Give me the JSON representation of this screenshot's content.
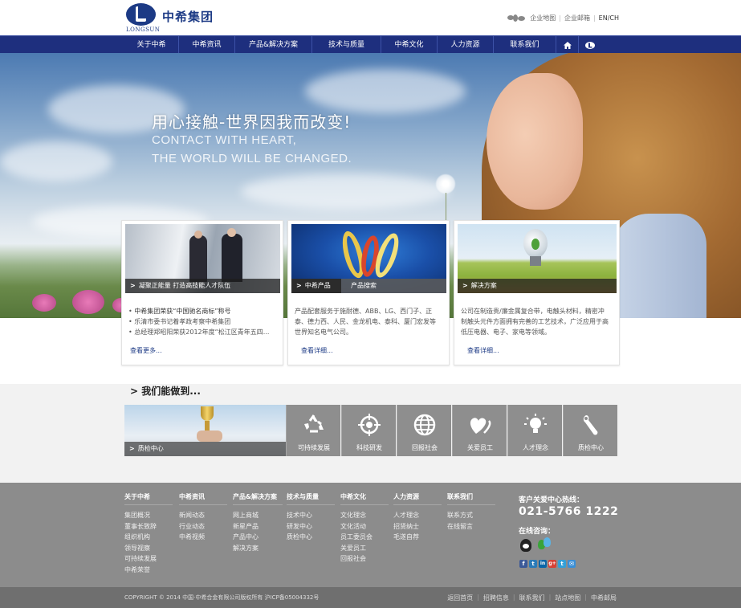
{
  "header": {
    "logo_cn": "中希集团",
    "logo_en": "LONGSUN",
    "links": [
      "企业地图",
      "企业邮箱",
      "EN/CH"
    ]
  },
  "nav": {
    "items": [
      "关于中希",
      "中希资讯",
      "产品&解决方案",
      "技术与质量",
      "中希文化",
      "人力资源",
      "联系我们"
    ],
    "home_icon": "home-icon",
    "logo_icon": "logo-small-icon"
  },
  "hero": {
    "title": "用心接触-世界因我而改变!",
    "subtitle_line1": "CONTACT WITH HEART,",
    "subtitle_line2": "THE WORLD WILL BE CHANGED."
  },
  "cards": [
    {
      "caption": "凝聚正能量 打造高技能人才队伍",
      "items": [
        "中希集团荣获“中国驰名商标”称号",
        "乐清市委书记着孝政考察中希集团",
        "总经理郑昭阳荣获2012年度“松江区青年五四..."
      ],
      "more": "查看更多..."
    },
    {
      "caption_tab1": "中希产品",
      "caption_tab2": "产品搜索",
      "text": "产品配套服务于施耐德、ABB、LG、西门子、正泰、德力西、人民、金龙机电、泰科、厦门宏发等世界知名电气公司。",
      "more": "查看详细..."
    },
    {
      "caption": "解决方案",
      "text": "公司在制造贵/廉金属复合带，电触头材料，精密冲制触头元件方面拥有完善的工艺技术，广泛应用于高低压电器、电子、家电等领域。",
      "more": "查看详细..."
    }
  ],
  "capabilities": {
    "title": "我们能做到...",
    "feature_caption": "质检中心",
    "tiles": [
      {
        "label": "可持续发展",
        "icon": "recycle-icon"
      },
      {
        "label": "科技研发",
        "icon": "target-icon"
      },
      {
        "label": "回报社会",
        "icon": "globe-icon"
      },
      {
        "label": "关爱员工",
        "icon": "hearts-icon"
      },
      {
        "label": "人才理念",
        "icon": "lightbulb-icon"
      },
      {
        "label": "质检中心",
        "icon": "wrench-icon"
      }
    ]
  },
  "footer": {
    "columns": [
      {
        "title": "关于中希",
        "items": [
          "集团概况",
          "董事长致辞",
          "组织机构",
          "领导视察",
          "可持续发展",
          "中希荣誉"
        ]
      },
      {
        "title": "中希资讯",
        "items": [
          "新闻动态",
          "行业动态",
          "中希视频"
        ]
      },
      {
        "title": "产品&解决方案",
        "items": [
          "网上商城",
          "新星产品",
          "产品中心",
          "解决方案"
        ]
      },
      {
        "title": "技术与质量",
        "items": [
          "技术中心",
          "研发中心",
          "质检中心"
        ]
      },
      {
        "title": "中希文化",
        "items": [
          "文化理念",
          "文化活动",
          "员工委员会",
          "关爱员工",
          "回报社会"
        ]
      },
      {
        "title": "人力资源",
        "items": [
          "人才理念",
          "招贤纳士",
          "毛遂自荐"
        ]
      },
      {
        "title": "联系我们",
        "items": [
          "联系方式",
          "在线留言"
        ]
      }
    ],
    "hotline_label": "客户关爱中心热线：",
    "hotline": "021-5766 1222",
    "online_label": "在线咨询：",
    "socials": [
      "f",
      "t",
      "in",
      "g+",
      "t",
      "✉"
    ],
    "social_colors": [
      "#3b5998",
      "#2a7ab8",
      "#0a66a8",
      "#d64136",
      "#33a0d8",
      "#3a8fd6"
    ]
  },
  "copyright": {
    "text": "COPYRIGHT © 2014 中国·中希合金有限公司版权所有  沪ICP备05004332号",
    "links": [
      "返回首页",
      "招聘信息",
      "联系我们",
      "站点地图",
      "中希邮局"
    ]
  }
}
